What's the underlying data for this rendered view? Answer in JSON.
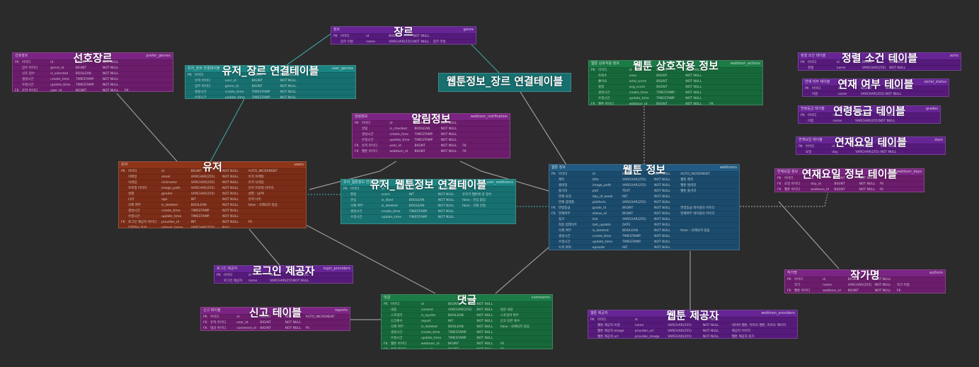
{
  "tables": [
    {
      "id": "genre",
      "title": "장르",
      "code": "장르",
      "name": "genre",
      "theme": "violet",
      "rows": [
        [
          "PK",
          "아이디",
          "id",
          "BIGINT",
          "NOT NULL",
          ""
        ],
        [
          "",
          "장르 이름",
          "name",
          "VARCHAR(255)",
          "NOT NULL",
          "장르 이름"
        ]
      ]
    },
    {
      "id": "prefer_genre",
      "title": "선호장르",
      "code": "선호장르",
      "name": "prefer_genres",
      "theme": "purple",
      "rows": [
        [
          "PK",
          "아이디",
          "id",
          "BIGINT",
          "NOT NULL",
          ""
        ],
        [
          "",
          "장르 아이디",
          "genre_id",
          "BIGINT",
          "NOT NULL",
          ""
        ],
        [
          "",
          "선호 점수",
          "is_selected",
          "BOOLEAN",
          "NOT NULL",
          ""
        ],
        [
          "",
          "생성시간",
          "create_time",
          "TIMESTAMP",
          "NOT NULL",
          ""
        ],
        [
          "",
          "수정시간",
          "update_time",
          "TIMESTAMP",
          "NOT NULL",
          ""
        ],
        [
          "FK",
          "유저 아이디",
          "user_id",
          "BIGINT",
          "NOT NULL",
          "FK"
        ]
      ]
    },
    {
      "id": "user_genre",
      "title": "유저_장르 연결테이블",
      "code": "유저_장르 연결테이블",
      "name": "user_genres",
      "theme": "teal",
      "rows": [
        [
          "PK",
          "아이디",
          "id",
          "BIGINT",
          "NOT NULL",
          ""
        ],
        [
          "",
          "유저 아이디",
          "user_id",
          "BIGINT",
          "NOT NULL",
          ""
        ],
        [
          "",
          "장르 아이디",
          "genre_id",
          "BIGINT",
          "NOT NULL",
          ""
        ],
        [
          "",
          "생성시간",
          "create_time",
          "TIMESTAMP",
          "NOT NULL",
          ""
        ],
        [
          "",
          "수정시간",
          "update_time",
          "TIMESTAMP",
          "NOT NULL",
          ""
        ]
      ]
    },
    {
      "id": "webtoon_genre",
      "title": "웹툰정보_장르 연결테이블",
      "code": "",
      "name": "",
      "theme": "teal",
      "rows": []
    },
    {
      "id": "alarm",
      "title": "알림정보",
      "code": "알림정보",
      "name": "webtoon_notification",
      "theme": "purple",
      "rows": [
        [
          "PK",
          "아이디",
          "id",
          "BIGINT",
          "NOT NULL",
          ""
        ],
        [
          "",
          "알림",
          "is_checked",
          "BOOLEAN",
          "NOT NULL",
          ""
        ],
        [
          "",
          "생성시간",
          "create_time",
          "TIMESTAMP",
          "NOT NULL",
          ""
        ],
        [
          "",
          "수정시간",
          "update_time",
          "TIMESTAMP",
          "NOT NULL",
          ""
        ],
        [
          "FK",
          "유저 아이디",
          "user_id",
          "BIGINT",
          "NOT NULL",
          "FK"
        ],
        [
          "FK",
          "웹툰 아이디",
          "webtoon_id",
          "BIGINT",
          "NOT NULL",
          "FK"
        ]
      ]
    },
    {
      "id": "interaction",
      "title": "웹툰 상호작용 정보",
      "code": "웹툰 상호작용 정보",
      "name": "webtoon_actions",
      "theme": "green",
      "rows": [
        [
          "PK",
          "아이디",
          "id",
          "BIGINT",
          "NOT NULL",
          ""
        ],
        [
          "",
          "조회수",
          "view",
          "BIGINT",
          "NOT NULL",
          ""
        ],
        [
          "",
          "좋아요",
          "total_score",
          "BIGINT",
          "NOT NULL",
          ""
        ],
        [
          "",
          "평점",
          "avg_score",
          "BIGINT",
          "NOT NULL",
          ""
        ],
        [
          "",
          "생성시간",
          "create_time",
          "TIMESTAMP",
          "NOT NULL",
          ""
        ],
        [
          "",
          "수정시간",
          "update_time",
          "TIMESTAMP",
          "NOT NULL",
          ""
        ],
        [
          "FK",
          "웹툰 아이디",
          "webtoon_id",
          "BIGINT",
          "NOT NULL",
          "FK"
        ]
      ]
    },
    {
      "id": "sort_cond",
      "title": "정렬 소건 테이블",
      "code": "정렬 조건 테이블",
      "name": "sorts",
      "theme": "violet",
      "rows": [
        [
          "PK",
          "아이디",
          "id",
          "BIGINT",
          "NOT NULL",
          ""
        ],
        [
          "",
          "정렬",
          "name",
          "VARCHAR(255)",
          "NOT NULL",
          ""
        ]
      ]
    },
    {
      "id": "serial_status",
      "title": "연재 여부 테이블",
      "code": "연재 여부 테이블",
      "name": "serial_status",
      "theme": "violet",
      "rows": [
        [
          "PK",
          "아이디",
          "id",
          "BIGINT",
          "NOT NULL",
          ""
        ],
        [
          "",
          "이름",
          "name",
          "VARCHAR(255)",
          "NOT NULL",
          ""
        ]
      ]
    },
    {
      "id": "age_grade",
      "title": "연령등급 테이블",
      "code": "연령등급 테이블",
      "name": "grades",
      "theme": "violet",
      "rows": [
        [
          "PK",
          "아이디",
          "id",
          "BIGINT",
          "NOT NULL",
          ""
        ],
        [
          "",
          "이름",
          "name",
          "VARCHAR(255)",
          "NOT NULL",
          ""
        ]
      ]
    },
    {
      "id": "serial_day",
      "title": "연재요일 테이블",
      "code": "연재요일 테이블",
      "name": "days",
      "theme": "violet",
      "rows": [
        [
          "PK",
          "아이디",
          "id",
          "BIGINT",
          "NOT NULL",
          ""
        ],
        [
          "",
          "요일",
          "day",
          "VARCHAR(255)",
          "NOT NULL",
          ""
        ]
      ]
    },
    {
      "id": "serial_day_info",
      "title": "연재요일 정보 테이블",
      "code": "연재요일 정보",
      "name": "webtoon_days",
      "theme": "purple",
      "rows": [
        [
          "PK",
          "아이디",
          "id",
          "BIGINT",
          "NOT NULL",
          ""
        ],
        [
          "FK",
          "요일 아이디",
          "day_id",
          "BIGINT",
          "NOT NULL",
          "FK"
        ],
        [
          "FK",
          "웹툰 아이디",
          "webtoon_id",
          "BIGINT",
          "NOT NULL",
          "FK"
        ]
      ]
    },
    {
      "id": "user",
      "title": "유저",
      "code": "유저",
      "name": "users",
      "theme": "rust",
      "rows": [
        [
          "PK",
          "아이디",
          "id",
          "BIGINT",
          "NOT NULL",
          "AUTO_INCREMENT"
        ],
        [
          "",
          "이메일",
          "email",
          "VARCHAR(255)",
          "NOT NULL",
          "유저 이메일"
        ],
        [
          "",
          "닉네임",
          "nickname",
          "VARCHAR(255)",
          "NOT NULL",
          "유저 닉네임"
        ],
        [
          "",
          "프로필 이미지",
          "image_path",
          "VARCHAR(255)",
          "NOT NULL",
          "유저 프로필 이미지"
        ],
        [
          "",
          "성별",
          "gender",
          "VARCHAR(255)",
          "NOT NULL",
          "성별 : 남/여"
        ],
        [
          "",
          "나이",
          "age",
          "INT",
          "NOT NULL",
          "유저 나이"
        ],
        [
          "",
          "삭제 여부",
          "is_deleted",
          "BOOLEAN",
          "NOT NULL",
          "false : 삭제되지 않음"
        ],
        [
          "",
          "생성시간",
          "create_time",
          "TIMESTAMP",
          "NOT NULL",
          ""
        ],
        [
          "",
          "수정시간",
          "update_time",
          "TIMESTAMP",
          "NOT NULL",
          ""
        ],
        [
          "FK",
          "로그인 제공자 아이디",
          "provider_id",
          "INT",
          "NOT NULL",
          "FK"
        ],
        [
          "",
          "리프레시 토큰",
          "refresh_token",
          "VARCHAR(255)",
          "NULL",
          ""
        ]
      ]
    },
    {
      "id": "user_webtoon",
      "title": "유저_웹툰정보 연결테이블",
      "code": "유저_웹툰정보 연결테이블",
      "name": "user_webtoons",
      "theme": "teal",
      "rows": [
        [
          "PK",
          "아이디",
          "id",
          "BIGINT",
          "NOT NULL",
          "PK"
        ],
        [
          "",
          "평점",
          "score",
          "INT",
          "NOT NULL",
          "유저가 웹툰에 준 점수"
        ],
        [
          "",
          "관심",
          "is_liked",
          "BOOLEAN",
          "NOT NULL",
          "false : 관심 없음"
        ],
        [
          "",
          "삭제 여부",
          "is_deleted",
          "BOOLEAN",
          "NOT NULL",
          "false : 삭제 안됨"
        ],
        [
          "",
          "생성시간",
          "create_time",
          "TIMESTAMP",
          "NOT NULL",
          ""
        ],
        [
          "",
          "수정시간",
          "update_time",
          "TIMESTAMP",
          "NOT NULL",
          ""
        ]
      ]
    },
    {
      "id": "webtoon",
      "title": "웹툰 정보",
      "code": "웹툰 정보",
      "name": "webtoons",
      "theme": "blue",
      "rows": [
        [
          "PK",
          "아이디",
          "id",
          "BIGINT",
          "NOT NULL",
          "AUTO_INCREMENT"
        ],
        [
          "",
          "제목",
          "title",
          "VARCHAR(255)",
          "NOT NULL",
          "웹툰 제목"
        ],
        [
          "",
          "썸네일",
          "image_path",
          "VARCHAR(255)",
          "NOT NULL",
          "웹툰 썸네일"
        ],
        [
          "",
          "줄거리",
          "plot",
          "TEXT",
          "NOT NULL",
          "웹툰 줄거리"
        ],
        [
          "",
          "연재 요일",
          "day_of_week",
          "INT",
          "NOT NULL",
          ""
        ],
        [
          "",
          "연재 플랫폼",
          "platform",
          "VARCHAR(255)",
          "NOT NULL",
          ""
        ],
        [
          "FK",
          "연령등급",
          "grade_id",
          "BIGINT",
          "NOT NULL",
          "연령등급 테이블의 아이디"
        ],
        [
          "FK",
          "연재여부",
          "status_id",
          "BIGINT",
          "NOT NULL",
          "연재여부 테이블의 아이디"
        ],
        [
          "",
          "링크",
          "link",
          "VARCHAR(255)",
          "NOT NULL",
          ""
        ],
        [
          "",
          "최종 업데이트",
          "last_update",
          "DATE",
          "NOT NULL",
          ""
        ],
        [
          "",
          "삭제 여부",
          "is_deleted",
          "BOOLEAN",
          "NOT NULL",
          "false : 삭제되지 않음"
        ],
        [
          "",
          "생성시간",
          "create_time",
          "TIMESTAMP",
          "NOT NULL",
          ""
        ],
        [
          "",
          "수정시간",
          "update_time",
          "TIMESTAMP",
          "NOT NULL",
          ""
        ],
        [
          "",
          "누적 회차",
          "episode",
          "INT",
          "NOT NULL",
          ""
        ],
        [
          "FK",
          "웹툰 제공자 아이디",
          "provider_id",
          "INT",
          "NOT NULL",
          "FK"
        ]
      ]
    },
    {
      "id": "login_provider",
      "title": "로그인 제공자",
      "code": "로그인 제공자",
      "name": "login_providers",
      "theme": "violet",
      "rows": [
        [
          "PK",
          "아이디",
          "id",
          "INT",
          "NOT NULL",
          ""
        ],
        [
          "",
          "로그인 제공자",
          "name",
          "VARCHAR(255)",
          "NOT NULL",
          ""
        ]
      ]
    },
    {
      "id": "author",
      "title": "작가명",
      "code": "작가명",
      "name": "authors",
      "theme": "purple",
      "rows": [
        [
          "PK",
          "아이디",
          "id",
          "BIGINT",
          "NOT NULL",
          ""
        ],
        [
          "",
          "작가",
          "name",
          "VARCHAR(255)",
          "NOT NULL",
          "작가 이름"
        ],
        [
          "FK",
          "웹툰 아이디",
          "webtoon_id",
          "BIGINT",
          "NOT NULL",
          "FK"
        ]
      ]
    },
    {
      "id": "report",
      "title": "신고 테이블",
      "code": "신고 테이블",
      "name": "reports",
      "theme": "purple",
      "rows": [
        [
          "PK",
          "아이디",
          "id",
          "BIGINT",
          "NOT NULL",
          "AUTO_INCREMENT"
        ],
        [
          "FK",
          "유저 아이디",
          "user_id",
          "BIGINT",
          "NOT NULL",
          ""
        ],
        [
          "FK",
          "댓글 아이디",
          "comment_id",
          "BIGINT",
          "NOT NULL",
          "FK"
        ]
      ]
    },
    {
      "id": "comment",
      "title": "댓글",
      "code": "댓글",
      "name": "comments",
      "theme": "green",
      "rows": [
        [
          "PK",
          "아이디",
          "id",
          "BIGINT",
          "NOT NULL",
          ""
        ],
        [
          "",
          "내용",
          "content",
          "VARCHAR(255)",
          "NOT NULL",
          "댓글 내용"
        ],
        [
          "",
          "스포일러",
          "is_spoiler",
          "BOOLEAN",
          "NOT NULL",
          "스포일러 여부"
        ],
        [
          "",
          "신고횟수",
          "report",
          "INT",
          "NOT NULL",
          "신고 당한 횟수"
        ],
        [
          "",
          "삭제 여부",
          "is_deleted",
          "BOOLEAN",
          "NOT NULL",
          "false : 삭제되지 않음"
        ],
        [
          "",
          "생성시간",
          "create_time",
          "TIMESTAMP",
          "NOT NULL",
          ""
        ],
        [
          "",
          "수정시간",
          "update_time",
          "TIMESTAMP",
          "NOT NULL",
          ""
        ],
        [
          "FK",
          "웹툰 아이디",
          "webtoon_id",
          "BIGINT",
          "NOT NULL",
          "FK"
        ],
        [
          "FK",
          "유저 아이디",
          "user_id",
          "BIGINT",
          "NOT NULL",
          "FK"
        ]
      ]
    },
    {
      "id": "webtoon_provider",
      "title": "웹툰 제공자",
      "code": "웹툰 제공자",
      "name": "webtoon_providers",
      "theme": "violet",
      "rows": [
        [
          "PK",
          "아이디",
          "id",
          "INT",
          "NOT NULL",
          ""
        ],
        [
          "",
          "웹툰 제공자 이름",
          "name",
          "VARCHAR(255)",
          "NOT NULL",
          "네이버 웹툰, 카카오 웹툰, 카카오 페이지"
        ],
        [
          "",
          "웹툰 제공자 image",
          "provider_url",
          "VARCHAR(255)",
          "NOT NULL",
          "제공자 이미지"
        ],
        [
          "",
          "웹툰 제공자 url",
          "provider_image",
          "VARCHAR(255)",
          "NOT NULL",
          "웹툰 제공자 링크"
        ]
      ]
    }
  ],
  "colors": {
    "background": "#2b2b2b",
    "link_teal": "#3d9c9a",
    "link_gray": "#9a9a9a"
  }
}
